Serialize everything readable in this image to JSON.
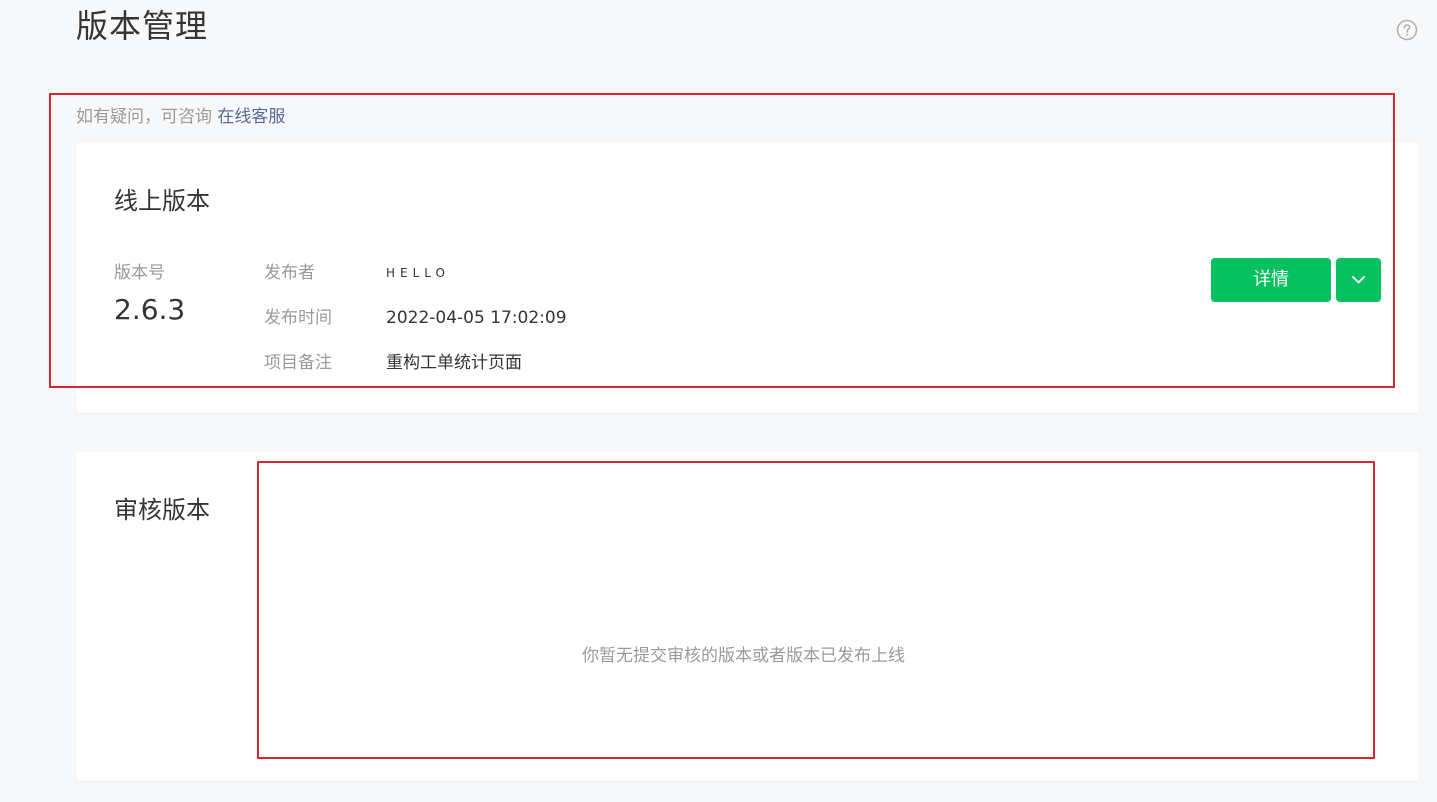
{
  "page": {
    "title": "版本管理",
    "help_icon": "question-circle-icon"
  },
  "consult": {
    "text": "如有疑问，可咨询",
    "link": "在线客服"
  },
  "online_version": {
    "title": "线上版本",
    "version_label": "版本号",
    "version_number": "2.6.3",
    "publisher_label": "发布者",
    "publisher_value": "HELLO",
    "time_label": "发布时间",
    "time_value": "2022-04-05 17:02:09",
    "note_label": "项目备注",
    "note_value": "重构工单统计页面",
    "detail_button": "详情",
    "more_icon": "chevron-down-icon",
    "accent_color": "#07c160"
  },
  "review_version": {
    "title": "审核版本",
    "empty_text": "你暂无提交审核的版本或者版本已发布上线"
  },
  "highlight_color": "#d9272e"
}
